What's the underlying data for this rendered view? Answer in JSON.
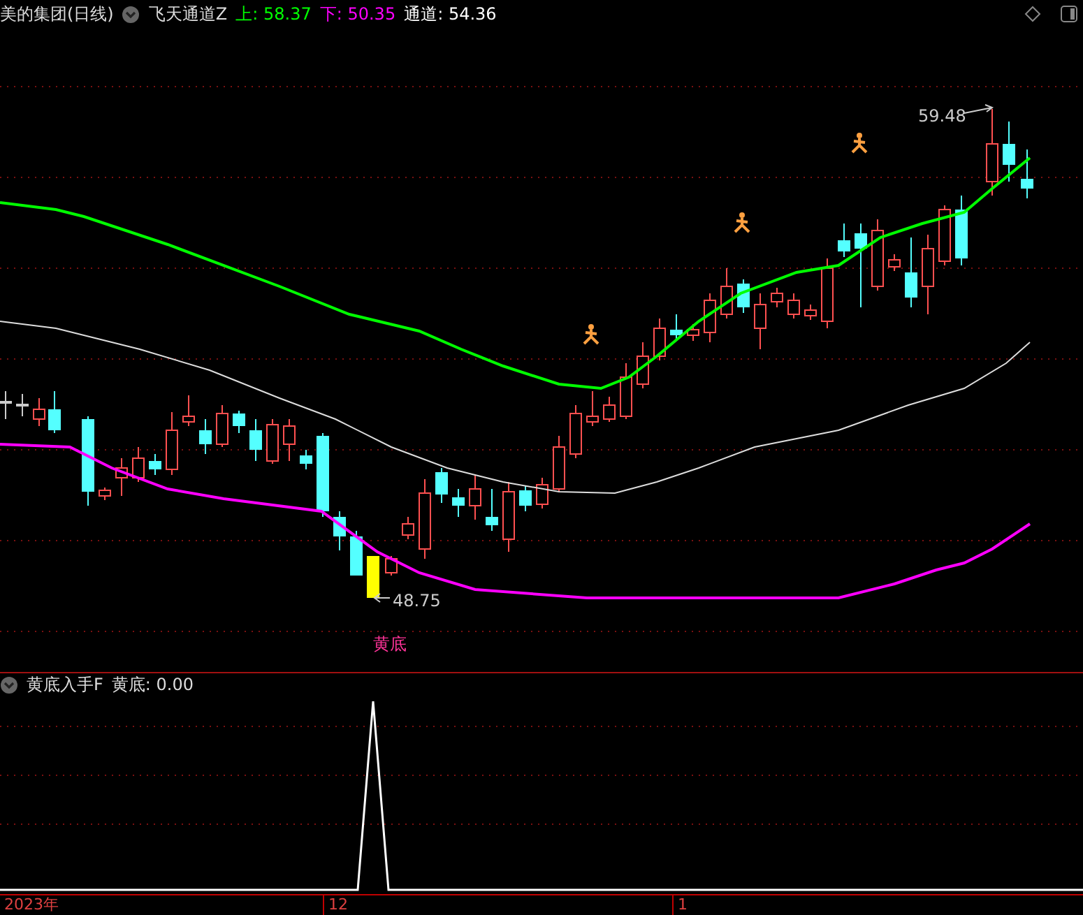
{
  "header": {
    "title": "美的集团(日线)",
    "indicator": "飞天通道Z",
    "readings": [
      {
        "label": "上:",
        "value": "58.37",
        "color": "#00ff00"
      },
      {
        "label": "下:",
        "value": "50.35",
        "color": "#ff00ff"
      },
      {
        "label": "通道:",
        "value": "54.36",
        "color": "#ffffff"
      }
    ]
  },
  "main_chart": {
    "high_label": "59.48",
    "low_label": "48.75",
    "signal_label": "黄底"
  },
  "sub_panel": {
    "indicator": "黄底入手F",
    "readings": [
      {
        "label": "黄底:",
        "value": "0.00"
      }
    ]
  },
  "x_axis": {
    "labels": [
      "2023年",
      "12",
      "1"
    ]
  }
}
